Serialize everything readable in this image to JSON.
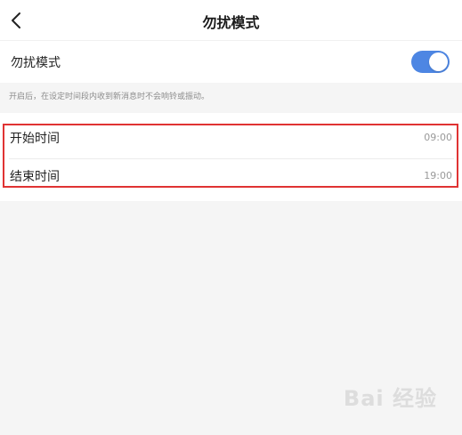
{
  "header": {
    "title": "勿扰模式",
    "back_icon": "chevron-left-icon"
  },
  "dnd": {
    "label": "勿扰模式",
    "enabled": true,
    "toggle_color": "#4d86e3"
  },
  "description": "开启后，在设定时间段内收到新消息时不会响铃或振动。",
  "times": [
    {
      "label": "开始时间",
      "value": "09:00"
    },
    {
      "label": "结束时间",
      "value": "19:00"
    }
  ],
  "watermark": "Bai 经验",
  "colors": {
    "highlight": "#e03333",
    "background": "#f5f5f5"
  }
}
